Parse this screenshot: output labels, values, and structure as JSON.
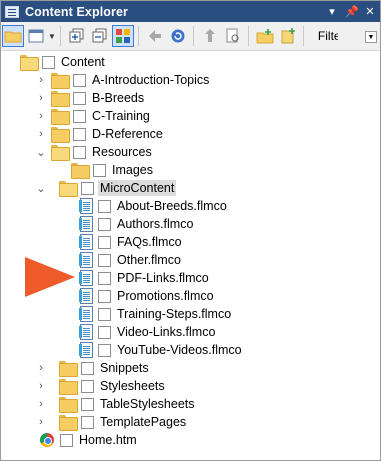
{
  "window": {
    "title": "Content Explorer"
  },
  "toolbar": {
    "filter_label": "Filter:"
  },
  "tree": {
    "root": "Content",
    "items": [
      "A-Introduction-Topics",
      "B-Breeds",
      "C-Training",
      "D-Reference",
      "Resources",
      "Images",
      "MicroContent",
      "About-Breeds.flmco",
      "Authors.flmco",
      "FAQs.flmco",
      "Other.flmco",
      "PDF-Links.flmco",
      "Promotions.flmco",
      "Training-Steps.flmco",
      "Video-Links.flmco",
      "YouTube-Videos.flmco",
      "Snippets",
      "Stylesheets",
      "TableStylesheets",
      "TemplatePages",
      "Home.htm"
    ]
  },
  "colors": {
    "titlebar": "#2b4e80",
    "callout_arrow": "#ee5a29",
    "selection": "#dcdcdc"
  }
}
